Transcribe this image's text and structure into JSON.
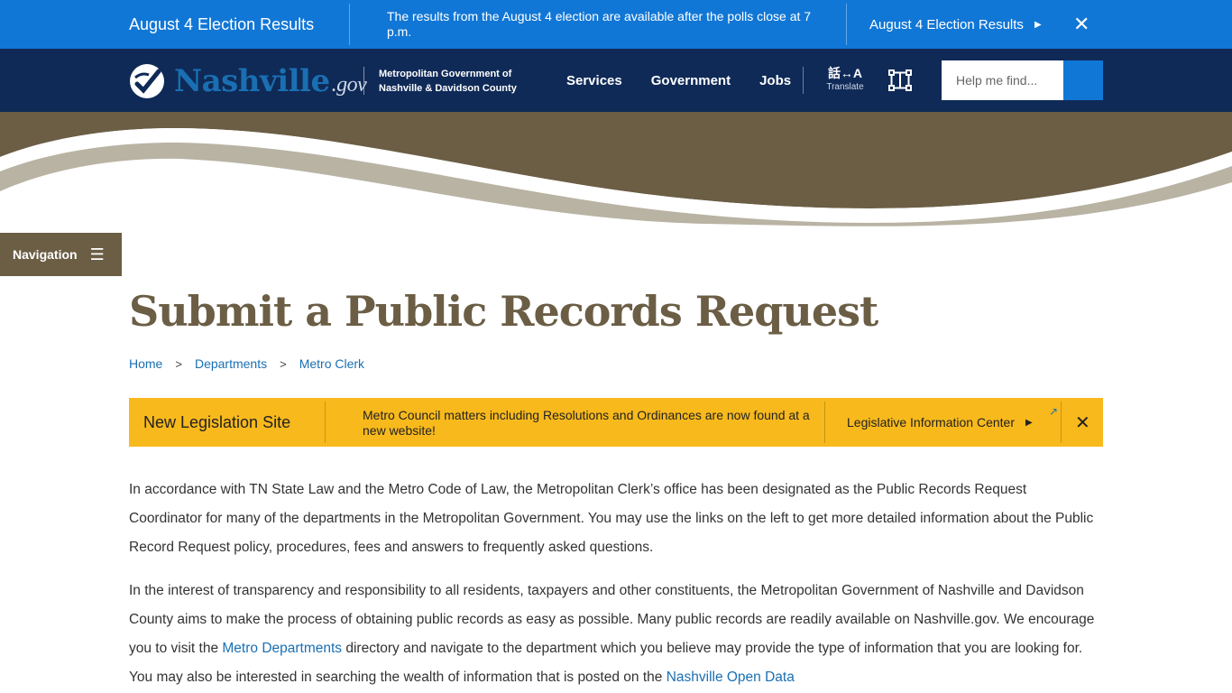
{
  "alert": {
    "title": "August 4 Election Results",
    "message": "The results from the August 4 election are available after the polls close at 7 p.m.",
    "link_label": "August 4 Election Results",
    "close_glyph": "✕"
  },
  "header": {
    "logo_text": "Nashville",
    "logo_suffix": ".gov",
    "subtitle_line1": "Metropolitan Government of",
    "subtitle_line2": "Nashville & Davidson County",
    "nav": [
      "Services",
      "Government",
      "Jobs"
    ],
    "translate_icon": "話↔A",
    "translate_label": "Translate",
    "search_placeholder": "Help me find...",
    "brand_color": "#0f2a57",
    "accent_color": "#1177d6"
  },
  "sidebar": {
    "nav_label": "Navigation",
    "menu_glyph": "☰"
  },
  "page": {
    "title": "Submit a Public Records Request",
    "title_color": "#6b5e45"
  },
  "breadcrumb": [
    {
      "label": "Home"
    },
    {
      "label": "Departments"
    },
    {
      "label": "Metro Clerk"
    }
  ],
  "legislation_alert": {
    "title": "New Legislation Site",
    "message": "Metro Council matters including Resolutions and Ordinances are now found at a new website!",
    "link_label": "Legislative Information Center",
    "close_glyph": "✕",
    "color": "#f8b91c"
  },
  "content": {
    "p1": "In accordance with TN State Law and the Metro Code of Law, the Metropolitan Clerk’s office has been designated as the Public Records Request Coordinator for many of the departments in the Metropolitan Government. You may use the links on the left to get more detailed information about the Public Record Request policy, procedures, fees and answers to frequently asked questions.",
    "p2_a": "In the interest of transparency and responsibility to all residents, taxpayers and other constituents, the Metropolitan Government of Nashville and Davidson County aims to make the process of obtaining public records as easy as possible. Many public records are readily available on Nashville.gov. We encourage you to visit the ",
    "p2_link1": "Metro Departments",
    "p2_b": " directory and navigate to the department which you believe may provide the type of information that you are looking for. You may also be interested in searching the wealth of information that is posted on the ",
    "p2_link2": "Nashville Open Data"
  }
}
